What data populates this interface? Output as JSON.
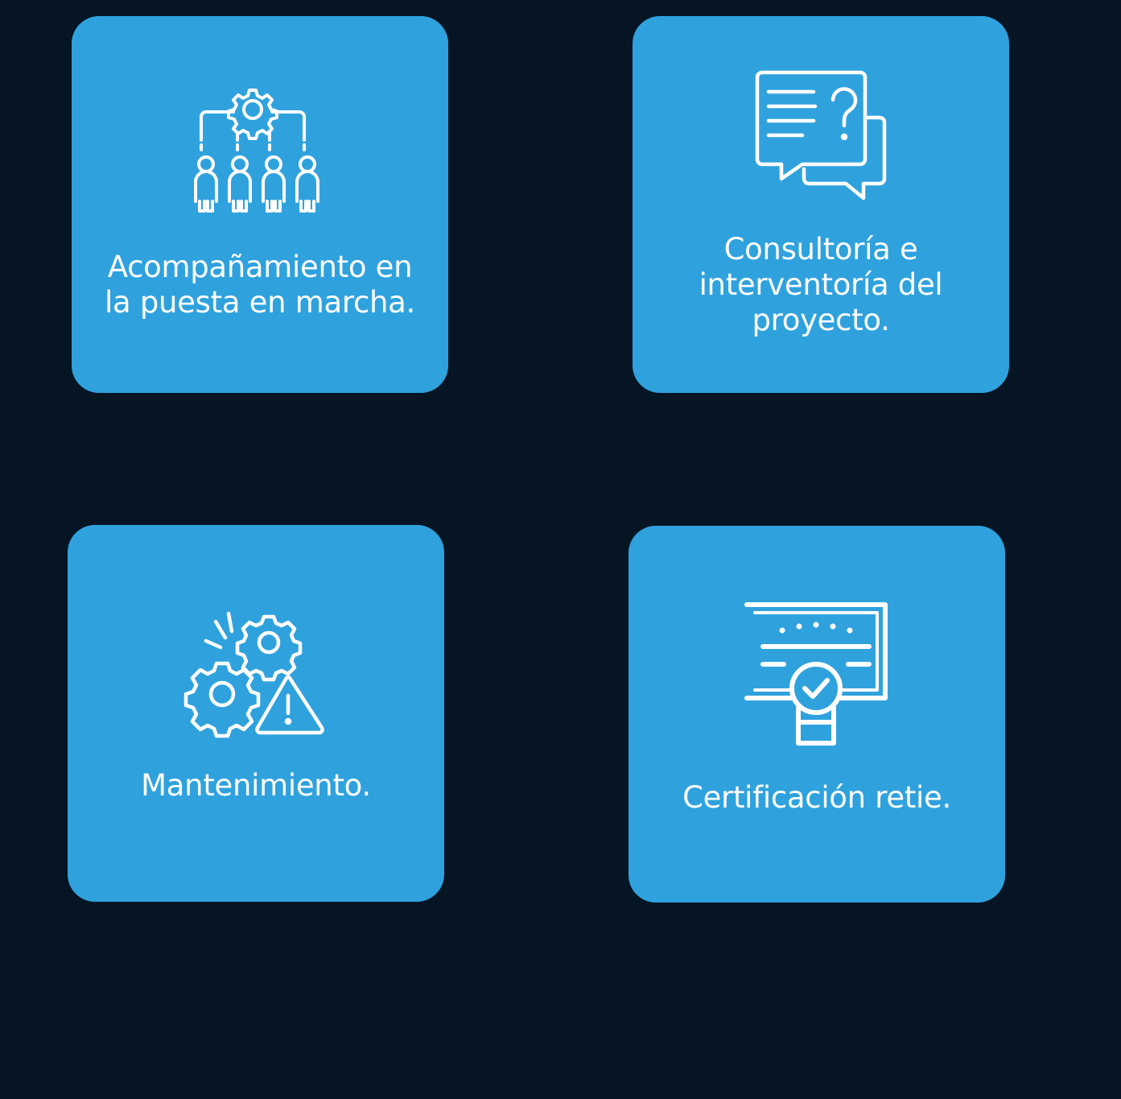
{
  "services": [
    {
      "icon": "team-gear-icon",
      "label_lines": [
        "Acompañamiento en",
        "la puesta en marcha."
      ]
    },
    {
      "icon": "chat-question-icon",
      "label_lines": [
        "Consultoría e",
        "interventoría del",
        "proyecto."
      ]
    },
    {
      "icon": "gears-warning-icon",
      "label_lines": [
        "Mantenimiento."
      ]
    },
    {
      "icon": "certificate-icon",
      "label_lines": [
        "Certificación retie."
      ]
    }
  ],
  "colors": {
    "background": "#051524",
    "card": "#2fa2de",
    "text": "#ffffff"
  }
}
